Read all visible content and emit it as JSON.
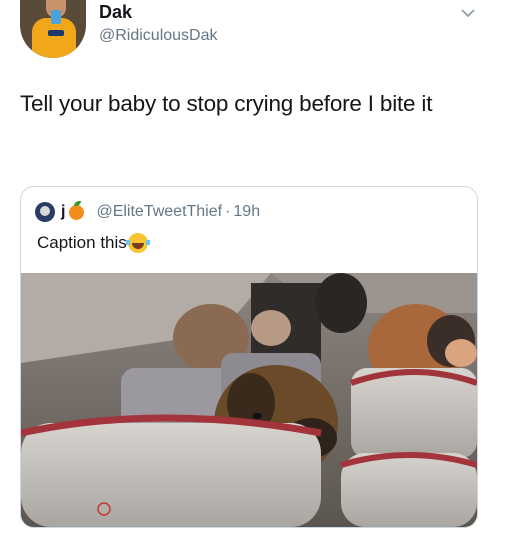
{
  "tweet": {
    "name": "Dak",
    "handle": "@RidiculousDak",
    "text": "Tell your baby to stop crying before I bite it"
  },
  "quoted": {
    "name": "j",
    "handle": "@EliteTweetThief",
    "separator": "·",
    "time": "19h",
    "text": "Caption this",
    "emoji": "laughing-with-tears"
  },
  "colors": {
    "primary_text": "#14171a",
    "secondary_text": "#657786",
    "border": "#ccd6dd"
  }
}
